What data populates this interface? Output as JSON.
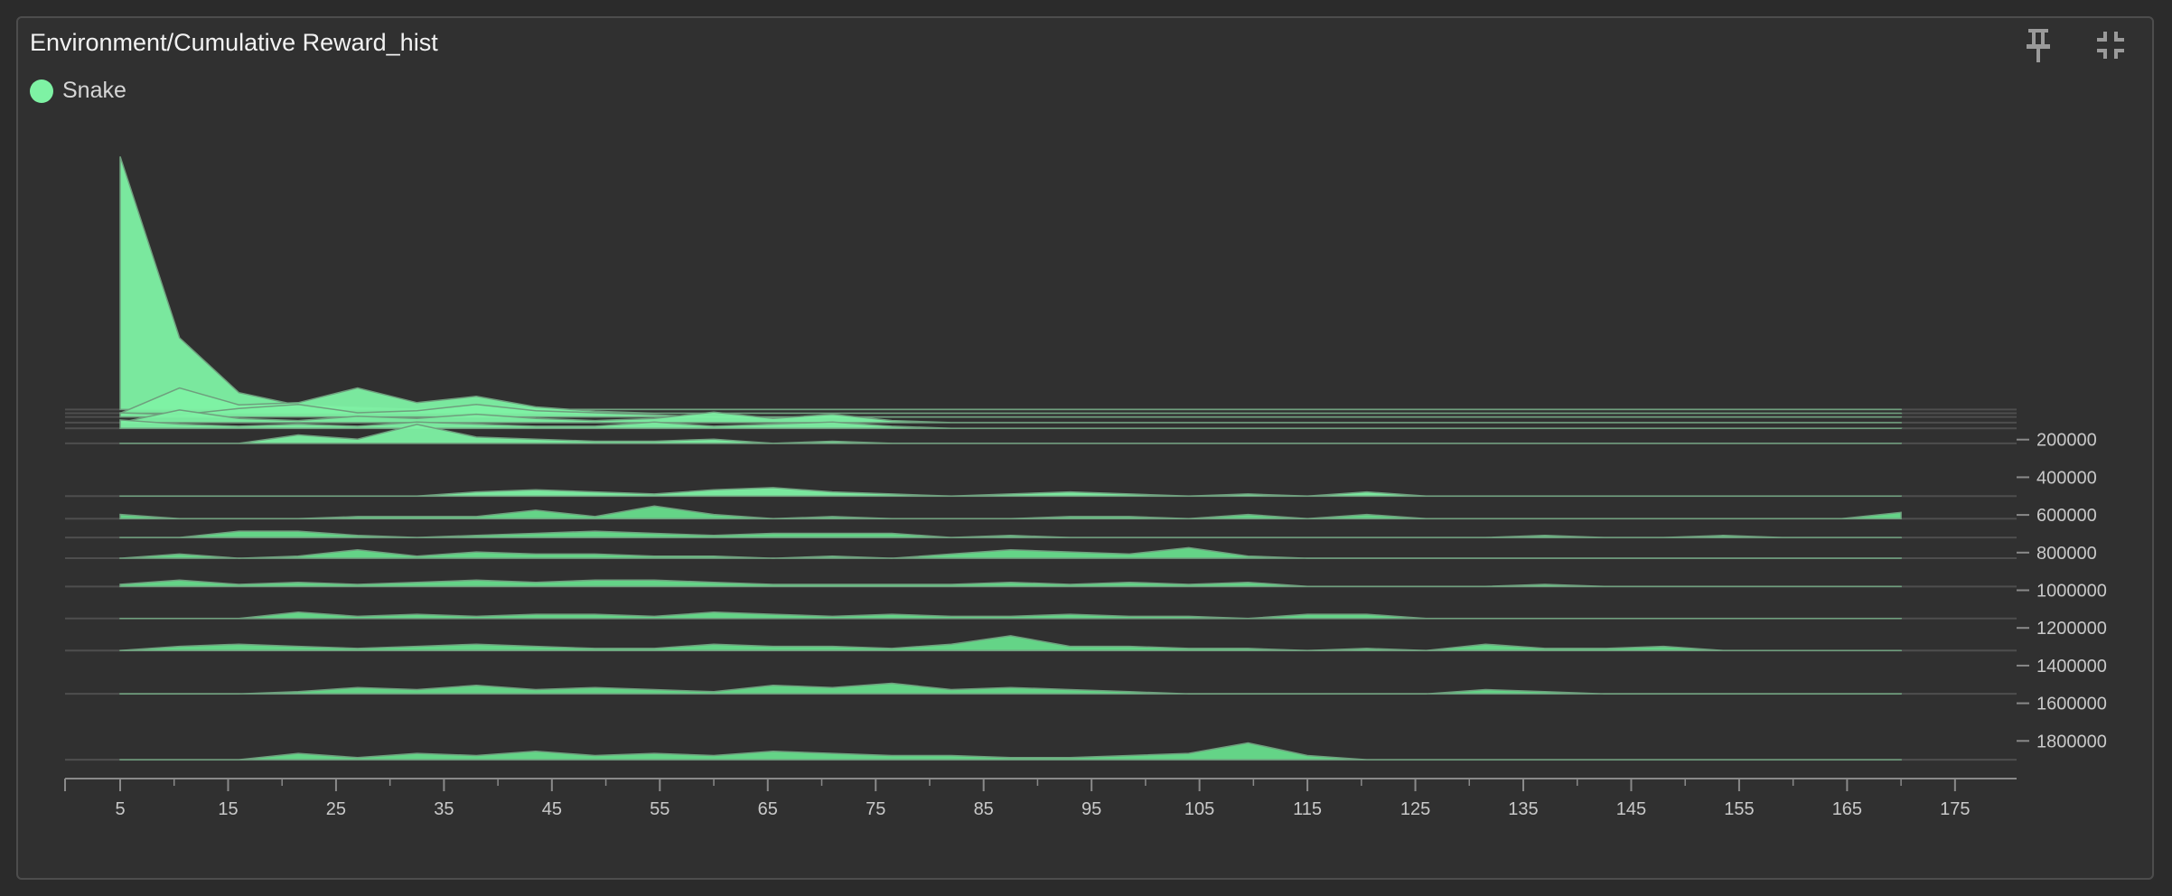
{
  "panel": {
    "title": "Environment/Cumulative Reward_hist"
  },
  "colors": {
    "series": "#7ef2a4",
    "background": "#303030",
    "axis": "#8a8a8a"
  },
  "toolbar": {
    "pin_icon": "pin-icon",
    "collapse_icon": "collapse-icon"
  },
  "chart_data": {
    "type": "histogram",
    "title": "Environment/Cumulative Reward_hist",
    "legend": [
      {
        "name": "Snake",
        "color": "#7ef2a4"
      }
    ],
    "legend_position": "top-left",
    "x_axis": {
      "min": 5,
      "max": 172,
      "ticks": [
        5,
        15,
        25,
        35,
        45,
        55,
        65,
        75,
        85,
        95,
        105,
        115,
        125,
        135,
        145,
        155,
        165,
        175
      ]
    },
    "step_axis": {
      "ticks": [
        200000,
        400000,
        600000,
        800000,
        1000000,
        1200000,
        1400000,
        1600000,
        1800000
      ]
    },
    "bin_centers": [
      5,
      10.5,
      16,
      21.5,
      27,
      32.5,
      38,
      43.5,
      49,
      54.5,
      60,
      65.5,
      71,
      76.5,
      82,
      87.5,
      93,
      98.5,
      104,
      109.5,
      115,
      120.5,
      126,
      131.5,
      137,
      142.5,
      148,
      153.5,
      159,
      164.5,
      170
    ],
    "series": [
      {
        "name": "Snake",
        "step": 40000,
        "counts": [
          120,
          34,
          8,
          2,
          1,
          0,
          0,
          0,
          0,
          0,
          0,
          0,
          0,
          0,
          0,
          0,
          0,
          0,
          0,
          0,
          0,
          0,
          0,
          0,
          0,
          0,
          0,
          0,
          0,
          0,
          0
        ]
      },
      {
        "name": "Snake",
        "step": 60000,
        "counts": [
          0,
          12,
          4,
          5,
          12,
          5,
          8,
          3,
          1,
          0,
          0,
          0,
          0,
          0,
          0,
          0,
          0,
          0,
          0,
          0,
          0,
          0,
          0,
          0,
          0,
          0,
          0,
          0,
          0,
          0,
          0
        ]
      },
      {
        "name": "Snake",
        "step": 80000,
        "counts": [
          2,
          1,
          4,
          6,
          2,
          3,
          6,
          3,
          2,
          1,
          0,
          0,
          0,
          0,
          0,
          0,
          0,
          0,
          0,
          0,
          0,
          0,
          0,
          0,
          0,
          0,
          0,
          0,
          0,
          0,
          0
        ]
      },
      {
        "name": "Snake",
        "step": 110000,
        "counts": [
          0,
          6,
          2,
          1,
          3,
          2,
          4,
          2,
          1,
          2,
          5,
          2,
          4,
          1,
          0,
          0,
          0,
          0,
          0,
          0,
          0,
          0,
          0,
          0,
          0,
          0,
          0,
          0,
          0,
          0,
          0
        ]
      },
      {
        "name": "Snake",
        "step": 140000,
        "counts": [
          4,
          2,
          1,
          2,
          1,
          3,
          2,
          1,
          1,
          3,
          1,
          2,
          3,
          1,
          0,
          0,
          0,
          0,
          0,
          0,
          0,
          0,
          0,
          0,
          0,
          0,
          0,
          0,
          0,
          0,
          0
        ]
      },
      {
        "name": "Snake",
        "step": 220000,
        "counts": [
          0,
          0,
          0,
          4,
          2,
          9,
          3,
          2,
          1,
          1,
          2,
          0,
          1,
          0,
          0,
          0,
          0,
          0,
          0,
          0,
          0,
          0,
          0,
          0,
          0,
          0,
          0,
          0,
          0,
          0,
          0
        ]
      },
      {
        "name": "Snake",
        "step": 500000,
        "counts": [
          0,
          0,
          0,
          0,
          0,
          0,
          2,
          3,
          2,
          1,
          3,
          4,
          2,
          1,
          0,
          1,
          2,
          1,
          0,
          1,
          0,
          2,
          0,
          0,
          0,
          0,
          0,
          0,
          0,
          0,
          0
        ]
      },
      {
        "name": "Snake",
        "step": 620000,
        "counts": [
          2,
          0,
          0,
          0,
          1,
          1,
          1,
          4,
          1,
          6,
          2,
          0,
          1,
          0,
          0,
          0,
          1,
          1,
          0,
          2,
          0,
          2,
          0,
          0,
          0,
          0,
          0,
          0,
          0,
          0,
          3
        ]
      },
      {
        "name": "Snake",
        "step": 720000,
        "counts": [
          0,
          0,
          3,
          3,
          1,
          0,
          1,
          2,
          3,
          2,
          1,
          2,
          2,
          2,
          0,
          1,
          0,
          0,
          0,
          0,
          0,
          0,
          0,
          0,
          1,
          0,
          0,
          1,
          0,
          0,
          0
        ]
      },
      {
        "name": "Snake",
        "step": 830000,
        "counts": [
          0,
          2,
          0,
          1,
          4,
          1,
          3,
          2,
          2,
          1,
          1,
          0,
          1,
          0,
          2,
          4,
          3,
          2,
          5,
          1,
          0,
          0,
          0,
          0,
          0,
          0,
          0,
          0,
          0,
          0,
          0
        ]
      },
      {
        "name": "Snake",
        "step": 980000,
        "counts": [
          1,
          3,
          1,
          2,
          1,
          2,
          3,
          2,
          3,
          3,
          2,
          1,
          1,
          1,
          1,
          2,
          1,
          2,
          1,
          2,
          0,
          0,
          0,
          0,
          1,
          0,
          0,
          0,
          0,
          0,
          0
        ]
      },
      {
        "name": "Snake",
        "step": 1150000,
        "counts": [
          0,
          0,
          0,
          3,
          1,
          2,
          1,
          2,
          2,
          1,
          3,
          2,
          1,
          2,
          1,
          1,
          2,
          1,
          1,
          0,
          2,
          2,
          0,
          0,
          0,
          0,
          0,
          0,
          0,
          0,
          0
        ]
      },
      {
        "name": "Snake",
        "step": 1320000,
        "counts": [
          0,
          2,
          3,
          2,
          1,
          2,
          3,
          2,
          1,
          1,
          3,
          2,
          2,
          1,
          3,
          7,
          2,
          2,
          1,
          1,
          0,
          1,
          0,
          3,
          1,
          1,
          2,
          0,
          0,
          0,
          0
        ]
      },
      {
        "name": "Snake",
        "step": 1550000,
        "counts": [
          0,
          0,
          0,
          1,
          3,
          2,
          4,
          2,
          3,
          2,
          1,
          4,
          3,
          5,
          2,
          3,
          2,
          1,
          0,
          0,
          0,
          0,
          0,
          2,
          1,
          0,
          0,
          0,
          0,
          0,
          0
        ]
      },
      {
        "name": "Snake",
        "step": 1900000,
        "counts": [
          0,
          0,
          0,
          3,
          1,
          3,
          2,
          4,
          2,
          3,
          2,
          4,
          3,
          2,
          2,
          1,
          1,
          2,
          3,
          8,
          2,
          0,
          0,
          0,
          0,
          0,
          0,
          0,
          0,
          0,
          0
        ]
      }
    ]
  }
}
